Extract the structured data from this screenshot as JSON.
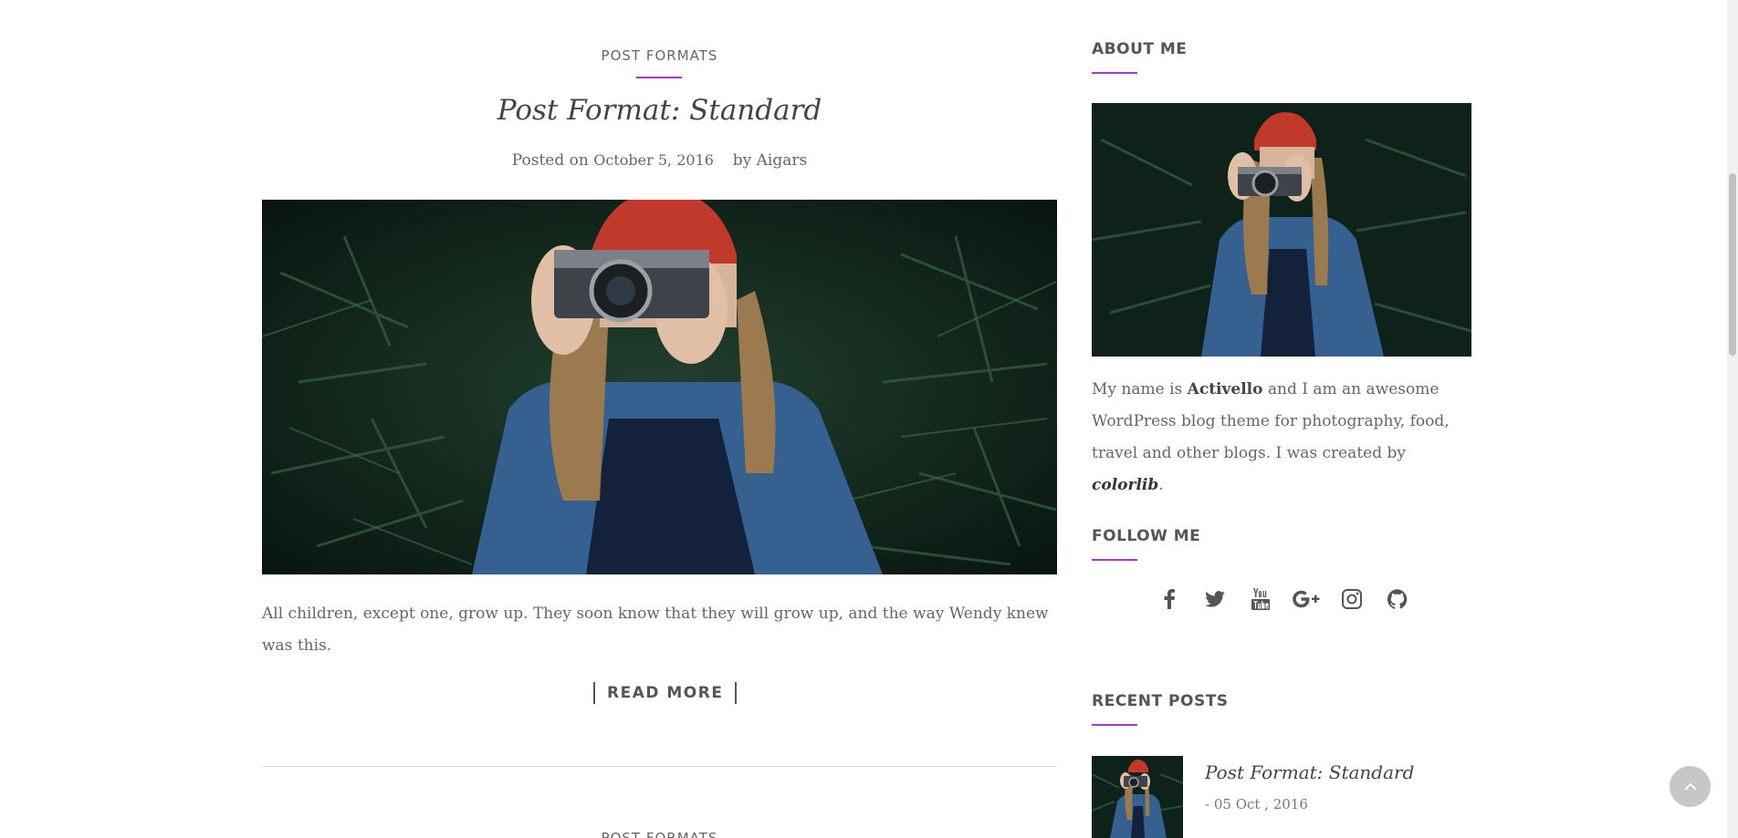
{
  "post": {
    "category": "POST FORMATS",
    "title": "Post Format: Standard",
    "meta_prefix": "Posted on",
    "date": "October 5, 2016",
    "by_label": "by",
    "author": "Aigars",
    "excerpt": "All children, except one, grow up. They soon know that they will grow up, and the way Wendy knew was this.",
    "read_more": "READ MORE"
  },
  "next_post": {
    "category": "POST FORMATS"
  },
  "sidebar": {
    "about_title": "ABOUT ME",
    "about_text_1": "My name is ",
    "about_name": "Activello",
    "about_text_2": " and I am an awesome WordPress blog theme for photography, food, travel and other blogs. I was created by ",
    "about_creator": "colorlib",
    "about_text_3": ".",
    "follow_title": "FOLLOW ME",
    "social_icons": [
      "facebook-icon",
      "twitter-icon",
      "youtube-icon",
      "google-plus-icon",
      "instagram-icon",
      "github-icon"
    ],
    "recent_title": "RECENT POSTS",
    "recent_posts": [
      {
        "title": "Post Format: Standard",
        "date": "- 05 Oct , 2016"
      }
    ]
  },
  "colors": {
    "accent": "#a23bd1",
    "text": "#555555",
    "back_to_top": "#c7c7c7"
  }
}
